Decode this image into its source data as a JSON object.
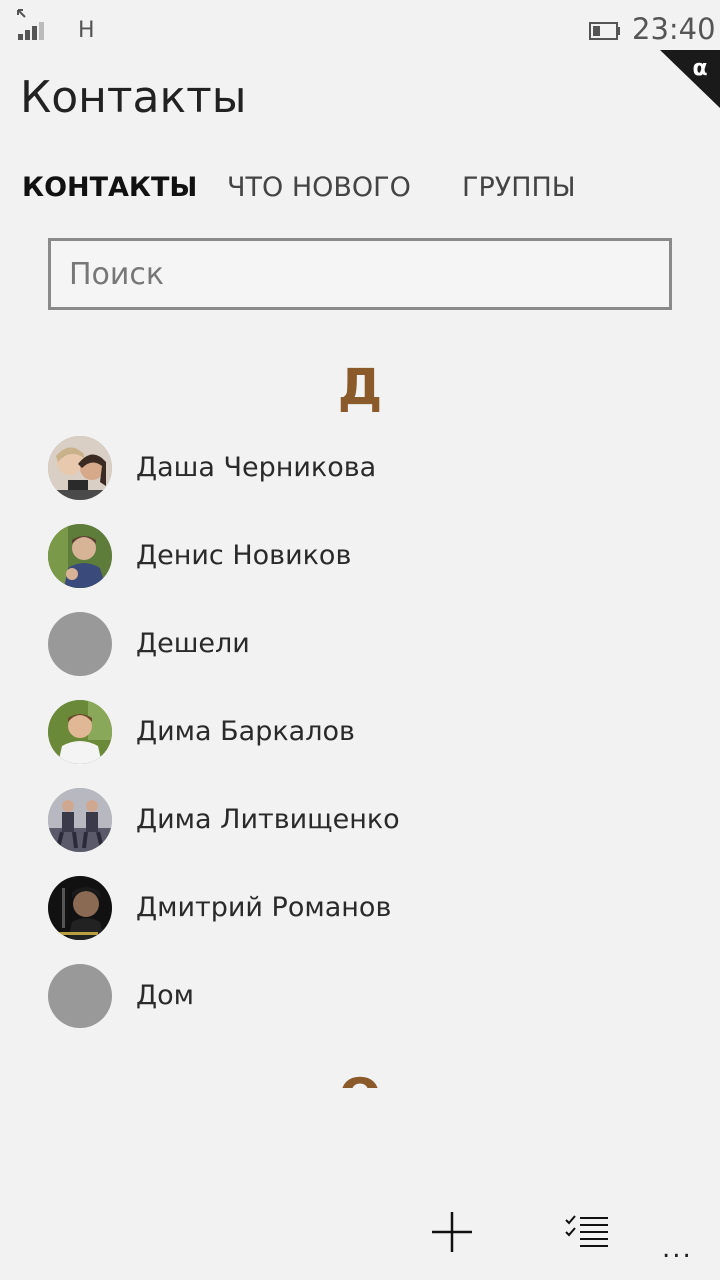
{
  "status_bar": {
    "network": "H",
    "time": "23:40",
    "icons": [
      "signal-icon",
      "battery-icon"
    ]
  },
  "app": {
    "title": "Контакты",
    "badge_icon": "alpha-icon"
  },
  "tabs": [
    {
      "label": "КОНТАКТЫ",
      "active": true
    },
    {
      "label": "ЧТО НОВОГО",
      "active": false
    },
    {
      "label": "ГРУППЫ",
      "active": false
    }
  ],
  "search": {
    "placeholder": "Поиск",
    "value": ""
  },
  "sections": [
    {
      "letter": "Д",
      "contacts": [
        {
          "name": "Даша Черникова",
          "avatar": "photo"
        },
        {
          "name": "Денис Новиков",
          "avatar": "photo"
        },
        {
          "name": "Дешели",
          "avatar": "placeholder"
        },
        {
          "name": "Дима Баркалов",
          "avatar": "photo"
        },
        {
          "name": "Дима Литвищенко",
          "avatar": "photo"
        },
        {
          "name": "Дмитрий Романов",
          "avatar": "photo"
        },
        {
          "name": "Дом",
          "avatar": "placeholder"
        }
      ]
    },
    {
      "letter": "О",
      "contacts": []
    }
  ],
  "app_bar": {
    "icons": [
      "add-icon",
      "select-list-icon"
    ],
    "more": "..."
  },
  "colors": {
    "background": "#f2f2f2",
    "accent": "#8b5a2b",
    "placeholder_avatar": "#999999"
  }
}
